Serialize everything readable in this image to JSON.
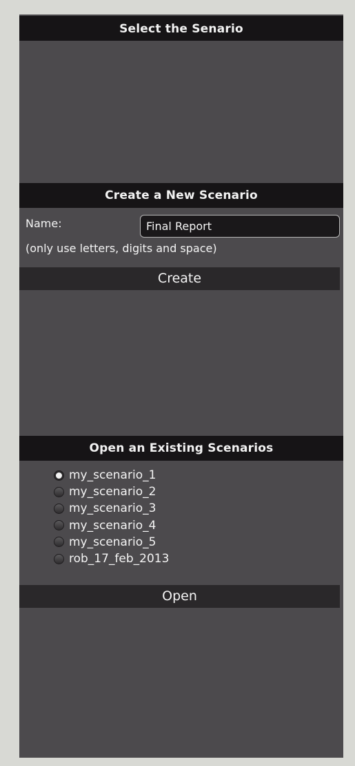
{
  "select_section": {
    "title": "Select the Senario"
  },
  "create_section": {
    "title": "Create a New Scenario",
    "name_label": "Name:",
    "name_value": "Final Report",
    "hint": "(only use letters, digits and space)",
    "create_label": "Create"
  },
  "open_section": {
    "title": "Open an Existing Scenarios",
    "scenarios": [
      {
        "label": "my_scenario_1",
        "checked": true
      },
      {
        "label": "my_scenario_2",
        "checked": false
      },
      {
        "label": "my_scenario_3",
        "checked": false
      },
      {
        "label": "my_scenario_4",
        "checked": false
      },
      {
        "label": "my_scenario_5",
        "checked": false
      },
      {
        "label": "rob_17_feb_2013",
        "checked": false
      }
    ],
    "open_label": "Open"
  },
  "colors": {
    "page_background": "#d8d9d4",
    "panel_background": "#4c4a4d",
    "header_background": "#161416",
    "button_background": "#2a282a"
  }
}
